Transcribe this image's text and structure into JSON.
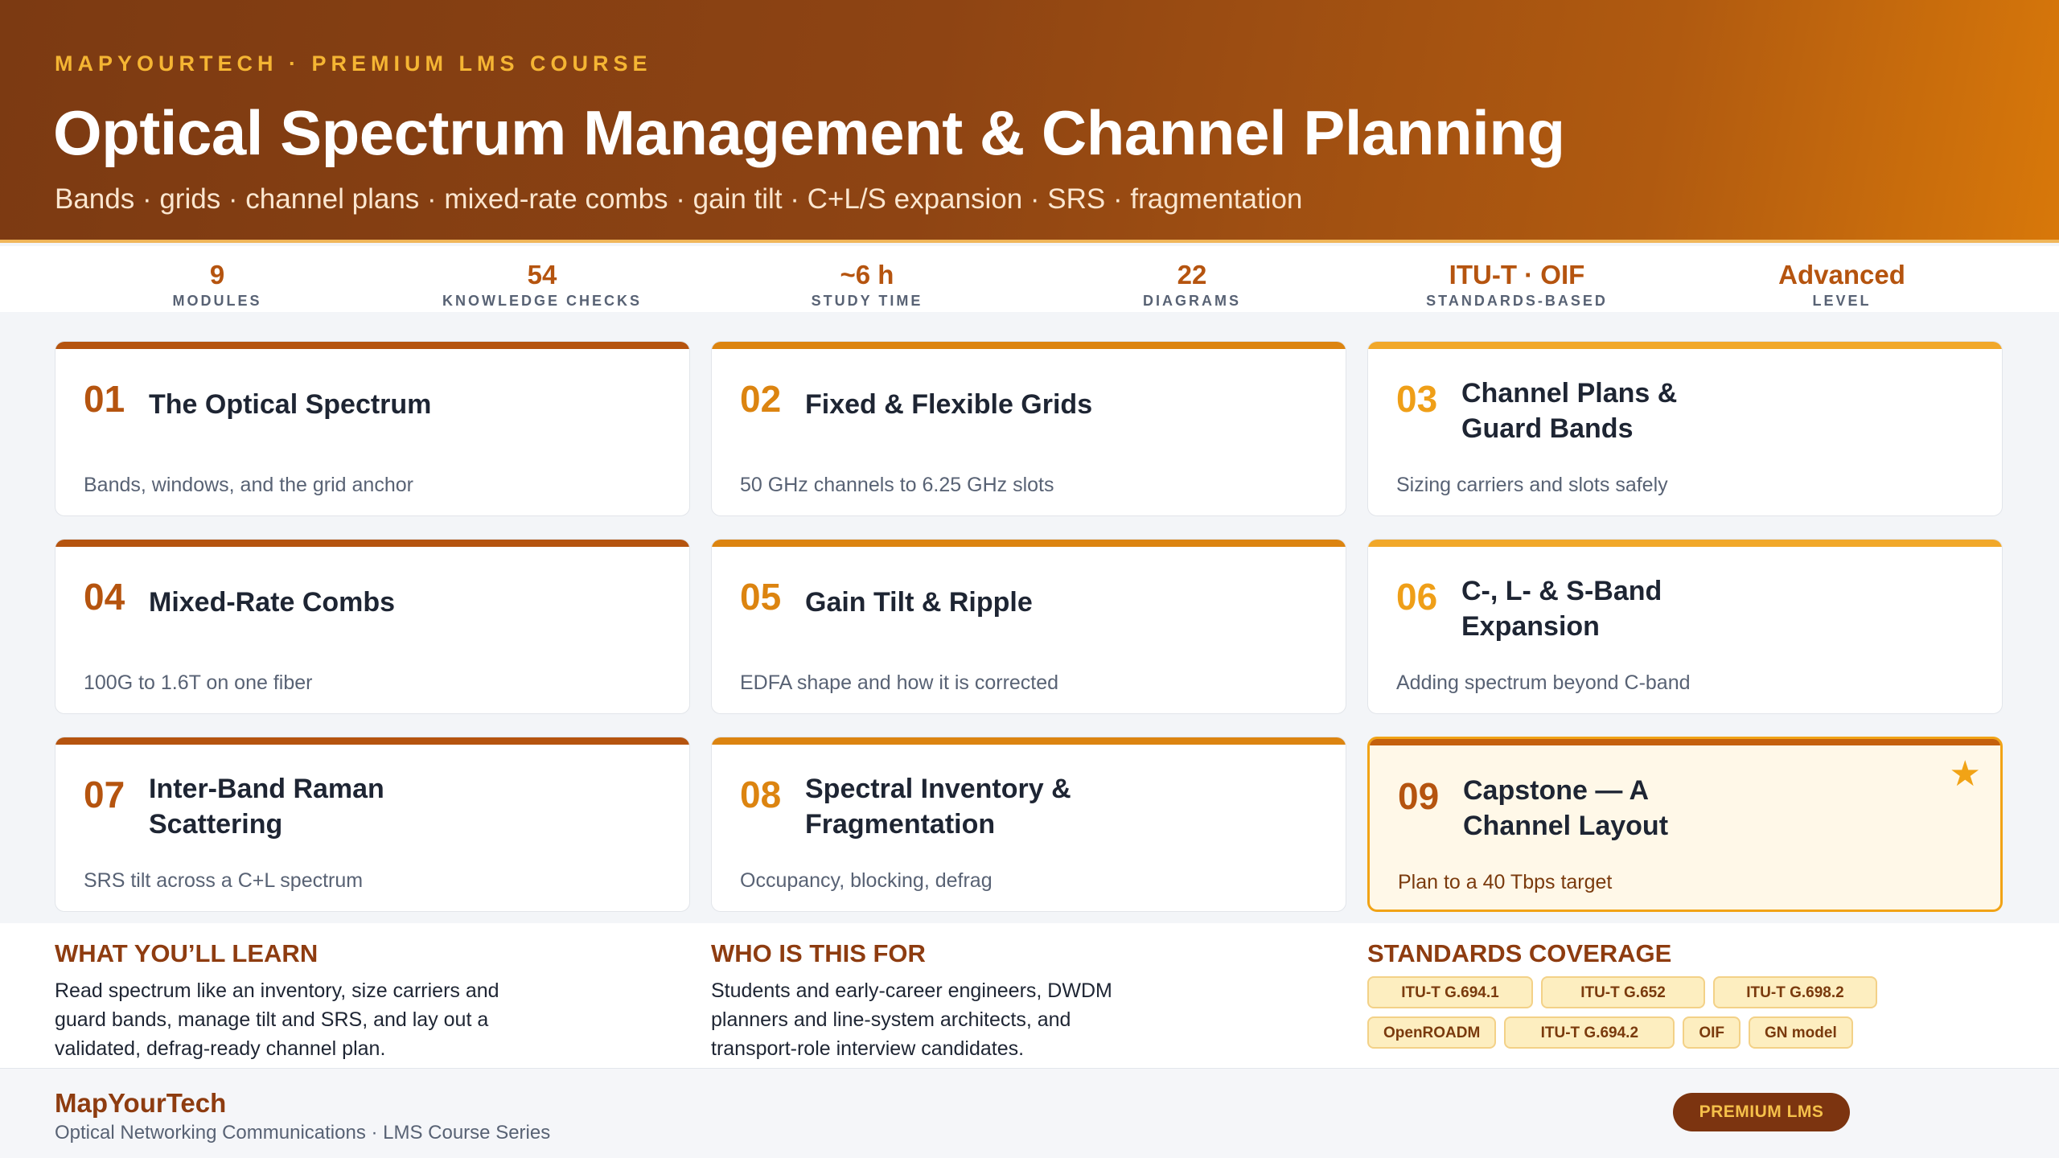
{
  "header": {
    "kicker": "MAPYOURTECH · PREMIUM LMS COURSE",
    "title": "Optical Spectrum Management & Channel Planning",
    "subtitle": "Bands · grids · channel plans · mixed-rate combs · gain tilt · C+L/S expansion · SRS · fragmentation"
  },
  "stats": [
    {
      "value": "9",
      "label": "MODULES"
    },
    {
      "value": "54",
      "label": "KNOWLEDGE CHECKS"
    },
    {
      "value": "~6 h",
      "label": "STUDY TIME"
    },
    {
      "value": "22",
      "label": "DIAGRAMS"
    },
    {
      "value": "ITU-T · OIF",
      "label": "STANDARDS-BASED"
    },
    {
      "value": "Advanced",
      "label": "LEVEL"
    }
  ],
  "modules": [
    {
      "num": "01",
      "title": "The Optical Spectrum",
      "desc": "Bands, windows, and the grid anchor"
    },
    {
      "num": "02",
      "title": "Fixed & Flexible Grids",
      "desc": "50 GHz channels to 6.25 GHz slots"
    },
    {
      "num": "03",
      "title": "Channel Plans & Guard Bands",
      "desc": "Sizing carriers and slots safely"
    },
    {
      "num": "04",
      "title": "Mixed-Rate Combs",
      "desc": "100G to 1.6T on one fiber"
    },
    {
      "num": "05",
      "title": "Gain Tilt & Ripple",
      "desc": "EDFA shape and how it is corrected"
    },
    {
      "num": "06",
      "title": "C-, L- & S-Band Expansion",
      "desc": "Adding spectrum beyond C-band"
    },
    {
      "num": "07",
      "title": "Inter-Band Raman Scattering",
      "desc": "SRS tilt across a C+L spectrum"
    },
    {
      "num": "08",
      "title": "Spectral Inventory & Fragmentation",
      "desc": "Occupancy, blocking, defrag"
    },
    {
      "num": "09",
      "title": "Capstone — A Channel Layout",
      "desc": "Plan to a 40 Tbps target",
      "icon": "star-icon"
    }
  ],
  "learn": {
    "heading": "WHAT YOU’LL LEARN",
    "text": "Read spectrum like an inventory, size carriers and guard bands, manage tilt and SRS, and lay out a validated, defrag-ready channel plan."
  },
  "audience": {
    "heading": "WHO IS THIS FOR",
    "text": "Students and early-career engineers, DWDM planners and line-system architects, and transport-role interview candidates."
  },
  "standards": {
    "heading": "STANDARDS COVERAGE",
    "items": [
      "ITU-T G.694.1",
      "ITU-T G.652",
      "ITU-T G.698.2",
      "OpenROADM",
      "ITU-T G.694.2",
      "OIF",
      "GN model"
    ]
  },
  "footer": {
    "brand": "MapYourTech",
    "series": "Optical Networking Communications · LMS Course Series",
    "badge": "PREMIUM LMS"
  },
  "colors": {
    "header_start": "#7c3a12",
    "header_end": "#d8780a",
    "accent_rust": "#b5540f",
    "accent_orange": "#dc8410",
    "accent_gold": "#f1a82a",
    "capstone_bg": "#fff8e8"
  }
}
